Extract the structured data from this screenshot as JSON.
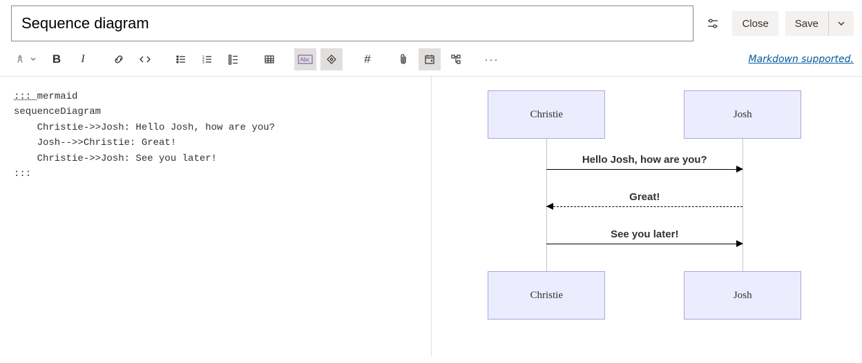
{
  "title": "Sequence diagram",
  "buttons": {
    "close": "Close",
    "save": "Save"
  },
  "toolbar": {
    "heading": "Heading",
    "bold": "Bold",
    "italic": "Italic",
    "link": "Link",
    "code": "Code",
    "ul": "Bulleted list",
    "ol": "Numbered list",
    "checklist": "Checklist",
    "table": "Table",
    "mention": "Mention",
    "collapse": "Collapse section",
    "hash": "Work item",
    "attach": "Attachment",
    "date": "Date",
    "query": "Query",
    "more": "More"
  },
  "markdown_link": "Markdown supported.",
  "editor": {
    "line1_fence": "::: ",
    "line1_lang": "mermaid",
    "line2": "sequenceDiagram",
    "line3": "    Christie->>Josh: Hello Josh, how are you?",
    "line4": "    Josh-->>Christie: Great!",
    "line5": "    Christie->>Josh: See you later!",
    "line6": ":::"
  },
  "diagram": {
    "actor1": "Christie",
    "actor2": "Josh",
    "msg1": "Hello Josh, how are you?",
    "msg2": "Great!",
    "msg3": "See you later!"
  }
}
